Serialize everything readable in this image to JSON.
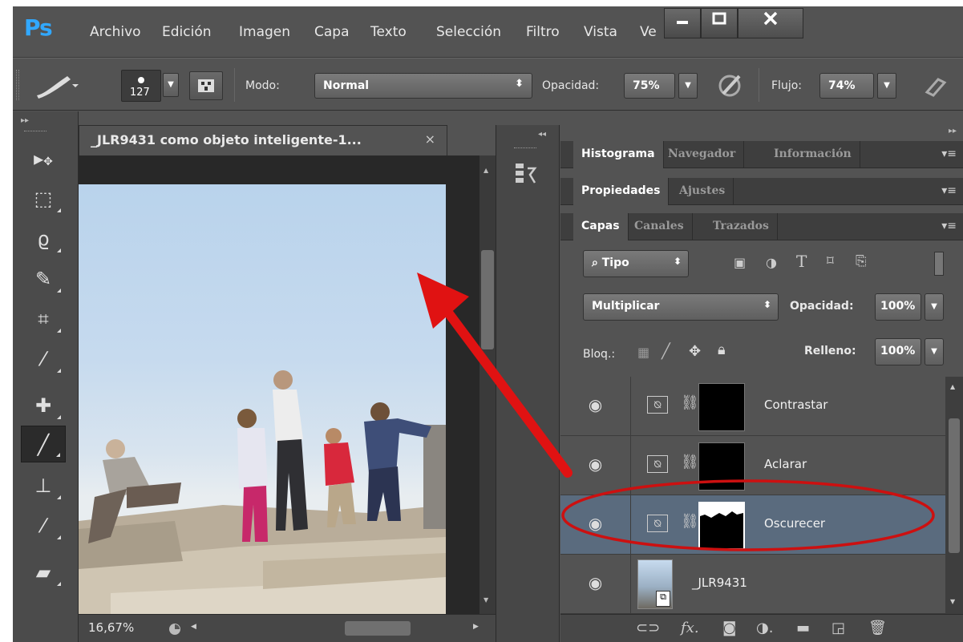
{
  "app": {
    "logo": "Ps",
    "menu": [
      "Archivo",
      "Edición",
      "Imagen",
      "Capa",
      "Texto",
      "Selección",
      "Filtro",
      "Vista",
      "Ve"
    ],
    "window_buttons": [
      "minimize",
      "maximize",
      "close"
    ]
  },
  "options": {
    "brush_size": "127",
    "mode_label": "Modo:",
    "mode_value": "Normal",
    "opacity_label": "Opacidad:",
    "opacity_value": "75%",
    "flow_label": "Flujo:",
    "flow_value": "74%"
  },
  "document": {
    "tab_title": "_JLR9431 como objeto inteligente-1...",
    "close_glyph": "×",
    "zoom": "16,67%"
  },
  "panels": {
    "group1_tabs": [
      "Histograma",
      "Navegador",
      "Información"
    ],
    "group2_tabs": [
      "Propiedades",
      "Ajustes"
    ],
    "group3_tabs": [
      "Capas",
      "Canales",
      "Trazados"
    ],
    "filter_kind": "Tipo",
    "blend_mode": "Multiplicar",
    "opacity_label": "Opacidad:",
    "opacity_value": "100%",
    "lock_label": "Bloq.:",
    "fill_label": "Relleno:",
    "fill_value": "100%"
  },
  "layers": [
    {
      "name": "Contrastar",
      "type": "adjustment",
      "selected": false
    },
    {
      "name": "Aclarar",
      "type": "adjustment",
      "selected": false
    },
    {
      "name": "Oscurecer",
      "type": "adjustment",
      "selected": true
    },
    {
      "name": "_JLR9431",
      "type": "smart-object",
      "selected": false
    }
  ],
  "colors": {
    "ps_blue": "#31a8ff",
    "selected_layer": "#5a6b7e",
    "annotation_red": "#e01212"
  },
  "icons": {
    "tools": [
      "move-icon",
      "marquee-icon",
      "lasso-icon",
      "quick-select-icon",
      "crop-icon",
      "eyedropper-icon",
      "healing-icon",
      "brush-icon",
      "stamp-icon",
      "history-brush-icon",
      "eraser-icon"
    ]
  }
}
